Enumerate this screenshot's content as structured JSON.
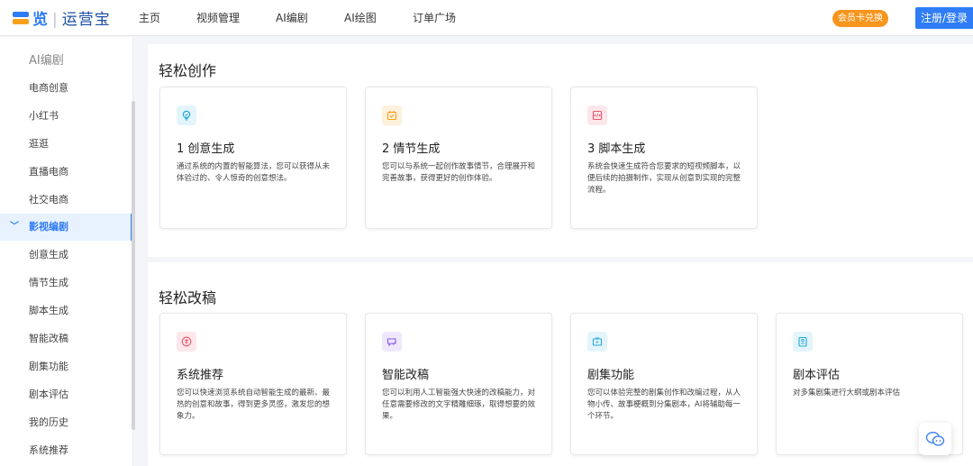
{
  "header": {
    "logo_main": "览",
    "logo_brand": "运营宝",
    "nav": [
      "主页",
      "视频管理",
      "AI编剧",
      "AI绘图",
      "订单广场"
    ],
    "vip_label": "会员卡兑换",
    "login_label": "注册/登录"
  },
  "sidebar": {
    "title": "AI编剧",
    "items": [
      {
        "label": "电商创意"
      },
      {
        "label": "小红书"
      },
      {
        "label": "逛逛"
      },
      {
        "label": "直播电商"
      },
      {
        "label": "社交电商"
      },
      {
        "label": "影视编剧",
        "active": true
      },
      {
        "label": "创意生成"
      },
      {
        "label": "情节生成"
      },
      {
        "label": "脚本生成"
      },
      {
        "label": "智能改稿"
      },
      {
        "label": "剧集功能"
      },
      {
        "label": "剧本评估"
      },
      {
        "label": "我的历史"
      },
      {
        "label": "系统推荐"
      }
    ]
  },
  "sections": [
    {
      "title": "轻松创作",
      "cards": [
        {
          "icon": "lightbulb-icon",
          "title": "1 创意生成",
          "desc": "通过系统的内置的智能算法，您可以获得从未体验过的、令人惊奇的创意想法。"
        },
        {
          "icon": "plot-icon",
          "title": "2 情节生成",
          "desc": "您可以与系统一起创作故事情节，合理展开和完善故事，获得更好的创作体验。"
        },
        {
          "icon": "script-icon",
          "title": "3 脚本生成",
          "desc": "系统会快速生成符合您要求的短视频脚本，以便后续的拍摄制作，实现从创意到实现的完整流程。"
        }
      ]
    },
    {
      "title": "轻松改稿",
      "cards": [
        {
          "icon": "recommend-icon",
          "title": "系统推荐",
          "desc": "您可以快速浏览系统自动智能生成的最新、最热的创意和故事，得到更多灵感，激发您的想象力。"
        },
        {
          "icon": "edit-icon",
          "title": "智能改稿",
          "desc": "您可以利用人工智能强大快速的改稿能力，对任意需要修改的文字精雕细琢，取得想要的效果。"
        },
        {
          "icon": "tv-icon",
          "title": "剧集功能",
          "desc": "您可以体验完整的剧集创作和改编过程，从人物小传、故事梗概到分集剧本，AI将辅助每一个环节。"
        },
        {
          "icon": "evaluate-icon",
          "title": "剧本评估",
          "desc": "对多集剧集进行大纲或剧本评估"
        }
      ]
    }
  ],
  "colors": {
    "primary": "#2f7cf6",
    "vip": "#f7951d",
    "lightbulb": "#22a8d8",
    "plot": "#f7a11a",
    "script": "#e9556b",
    "recommend": "#e9556b",
    "edit": "#8a5cf0",
    "tv": "#22a8d8",
    "evaluate": "#22a8d8"
  }
}
